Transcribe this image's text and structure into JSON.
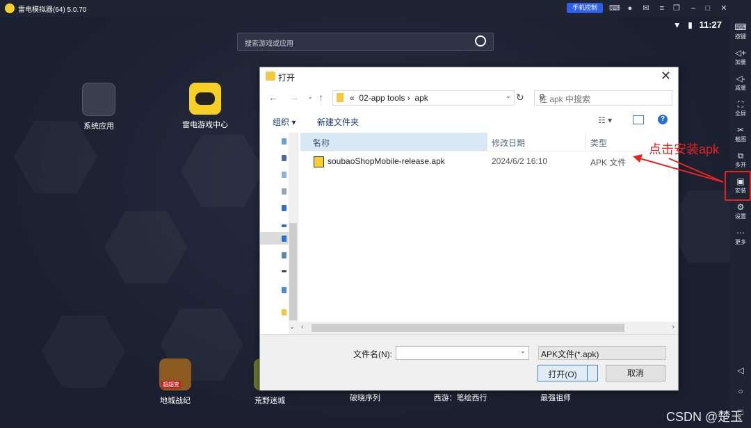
{
  "window": {
    "title": "雷电模拟器(64) 5.0.70",
    "phone_control": "手机控制"
  },
  "status_bar": {
    "time": "11:27"
  },
  "search": {
    "placeholder": "搜索游戏或应用"
  },
  "desktop_apps": [
    {
      "label": "系统应用",
      "icon": "system-apps-icon"
    },
    {
      "label": "雷电游戏中心",
      "icon": "game-center-icon"
    }
  ],
  "dock_apps": [
    {
      "label": "地城战纪"
    },
    {
      "label": "荒野迷城"
    },
    {
      "label": "破晓序列"
    },
    {
      "label": "西游：笔绘西行"
    },
    {
      "label": "最强祖师"
    }
  ],
  "dock_badge": "超超变",
  "sidebar": {
    "items": [
      {
        "label": "按键",
        "icon": "keyboard-icon"
      },
      {
        "label": "加量",
        "icon": "volume-up-icon"
      },
      {
        "label": "减量",
        "icon": "volume-down-icon"
      },
      {
        "label": "全屏",
        "icon": "fullscreen-icon"
      },
      {
        "label": "截图",
        "icon": "scissors-icon"
      },
      {
        "label": "多开",
        "icon": "multi-instance-icon"
      },
      {
        "label": "安装",
        "icon": "apk-install-icon"
      },
      {
        "label": "设置",
        "icon": "gear-icon"
      },
      {
        "label": "更多",
        "icon": "more-icon"
      }
    ]
  },
  "dialog": {
    "title": "打开",
    "address": {
      "sep": "«",
      "path1": "02-app tools",
      "path2": "apk"
    },
    "search_placeholder": "在 apk 中搜索",
    "toolbar": {
      "organize": "组织 ▾",
      "new_folder": "新建文件夹"
    },
    "columns": {
      "name": "名称",
      "date": "修改日期",
      "type": "类型"
    },
    "files": [
      {
        "name": "soubaoShopMobile-release.apk",
        "date": "2024/6/2 16:10",
        "type": "APK 文件"
      }
    ],
    "filename_label": "文件名(N):",
    "filename_value": "",
    "filetype": "APK文件(*.apk)",
    "open_button": "打开(O)",
    "cancel_button": "取消"
  },
  "annotation": {
    "text": "点击安装apk",
    "color": "#e8231f"
  },
  "watermark": "CSDN @楚玉"
}
